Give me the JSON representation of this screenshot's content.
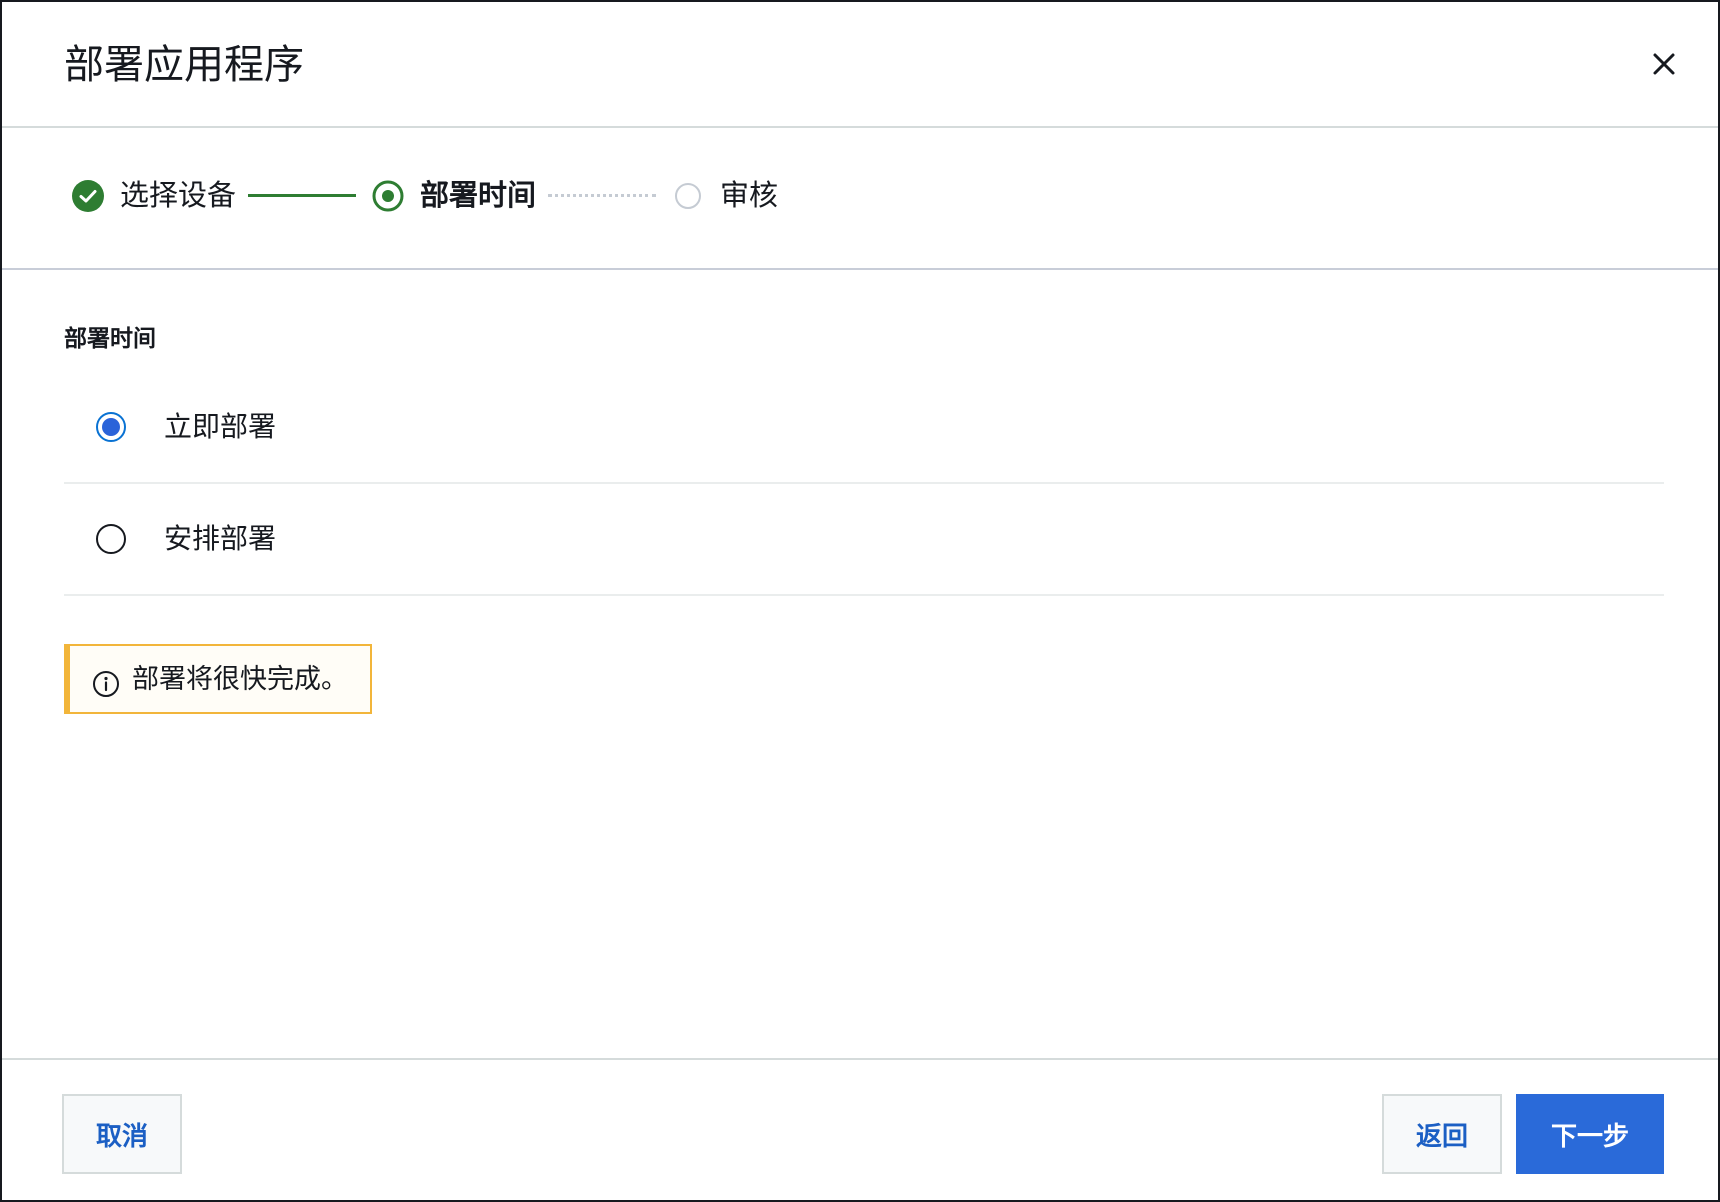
{
  "dialog": {
    "title": "部署应用程序",
    "close_icon": "close-icon"
  },
  "steps": [
    {
      "label": "选择设备",
      "status": "completed",
      "icon": "check-circle-icon"
    },
    {
      "label": "部署时间",
      "status": "current",
      "icon": "current-step-icon"
    },
    {
      "label": "审核",
      "status": "pending",
      "icon": "pending-step-icon"
    }
  ],
  "deploy_time": {
    "label": "部署时间",
    "options": [
      {
        "label": "立即部署",
        "selected": true
      },
      {
        "label": "安排部署",
        "selected": false
      }
    ]
  },
  "info_alert": {
    "icon": "info-icon",
    "text": "部署将很快完成。"
  },
  "footer": {
    "cancel_label": "取消",
    "back_label": "返回",
    "next_label": "下一步"
  },
  "colors": {
    "success_green": "#2e7d32",
    "primary_blue": "#2a6ad9",
    "warning_border": "#f2b53a",
    "pending_gray": "#c5cbd3"
  }
}
